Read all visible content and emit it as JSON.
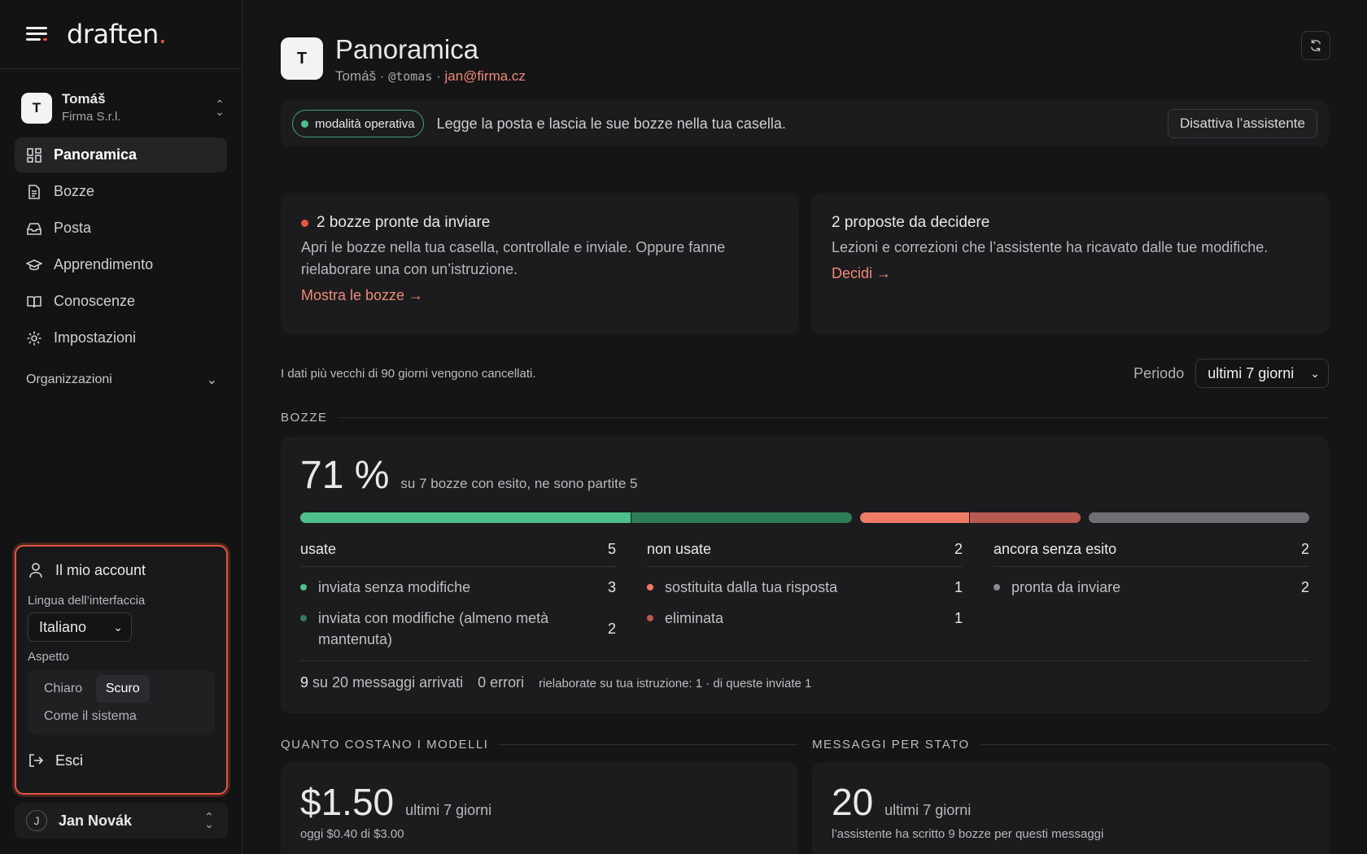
{
  "brand": {
    "name": "draften",
    "dot": "."
  },
  "workspace": {
    "initial": "T",
    "name": "Tomáš",
    "company": "Firma S.r.l."
  },
  "nav": [
    {
      "label": "Panoramica",
      "icon": "grid-icon",
      "active": true
    },
    {
      "label": "Bozze",
      "icon": "document-icon"
    },
    {
      "label": "Posta",
      "icon": "inbox-icon"
    },
    {
      "label": "Apprendimento",
      "icon": "graduation-cap-icon"
    },
    {
      "label": "Conoscenze",
      "icon": "book-icon"
    },
    {
      "label": "Impostazioni",
      "icon": "gear-icon"
    }
  ],
  "org_label": "Organizzazioni",
  "account": {
    "title": "Il mio account",
    "language_label": "Lingua dell’interfaccia",
    "language_value": "Italiano",
    "appearance_label": "Aspetto",
    "appearance_options": [
      "Chiaro",
      "Scuro",
      "Come il sistema"
    ],
    "appearance_selected": "Scuro",
    "logout": "Esci"
  },
  "user": {
    "initial": "J",
    "name": "Jan Novák"
  },
  "header": {
    "initial": "T",
    "title": "Panoramica",
    "name": "Tomáš",
    "sep": " · ",
    "handle": "@tomas",
    "email": "jan@firma.cz"
  },
  "status_bar": {
    "pill": "modalità operativa",
    "text": "Legge la posta e lascia le sue bozze nella tua casella.",
    "button": "Disattiva l’assistente"
  },
  "card_drafts": {
    "title": "2 bozze pronte da inviare",
    "text": "Apri le bozze nella tua casella, controllale e inviale. Oppure fanne rielaborare una con un’istruzione.",
    "link": "Mostra le bozze →"
  },
  "card_proposals": {
    "title": "2 proposte da decidere",
    "text": "Lezioni e correzioni che l’assistente ha ricavato dalle tue modifiche.",
    "link": "Decidi →"
  },
  "retention_note": "I dati più vecchi di 90 giorni vengono cancellati.",
  "period": {
    "label": "Periodo",
    "value": "ultimi 7 giorni"
  },
  "section_bozze": "BOZZE",
  "bozze": {
    "percent": "71 %",
    "desc": "su 7 bozze con esito, ne sono partite 5",
    "bar": [
      {
        "value": 3,
        "color": "#4fbf8b"
      },
      {
        "value": 2,
        "color": "#2f7d58"
      },
      {
        "value": 1,
        "color": "#ef7a66"
      },
      {
        "value": 1,
        "color": "#b95a50"
      },
      {
        "value": 2,
        "color": "#6e6e75"
      }
    ],
    "columns": [
      {
        "title": "usate",
        "count": "5",
        "items": [
          {
            "label": "inviata senza modifiche",
            "count": "3",
            "color": "#4fbf8b"
          },
          {
            "label": "inviata con modifiche (almeno metà mantenuta)",
            "count": "2",
            "color": "#2f7d58"
          }
        ]
      },
      {
        "title": "non usate",
        "count": "2",
        "items": [
          {
            "label": "sostituita dalla tua risposta",
            "count": "1",
            "color": "#ef7a66"
          },
          {
            "label": "eliminata",
            "count": "1",
            "color": "#b95a50"
          }
        ]
      },
      {
        "title": "ancora senza esito",
        "count": "2",
        "items": [
          {
            "label": "pronta da inviare",
            "count": "2",
            "color": "#8a8a90"
          }
        ]
      }
    ],
    "footer": {
      "arrived_num": "9",
      "arrived_text": "su 20 messaggi arrivati",
      "errors": "0 errori",
      "reworked": "rielaborate su tua istruzione: 1 · di queste inviate 1"
    }
  },
  "section_costs": "QUANTO COSTANO I MODELLI",
  "section_messages": "MESSAGGI PER STATO",
  "costs": {
    "value": "$1.50",
    "unit": "ultimi 7 giorni",
    "sub": "oggi $0.40 di $3.00"
  },
  "messages": {
    "value": "20",
    "unit": "ultimi 7 giorni",
    "sub": "l’assistente ha scritto 9 bozze per questi messaggi"
  }
}
